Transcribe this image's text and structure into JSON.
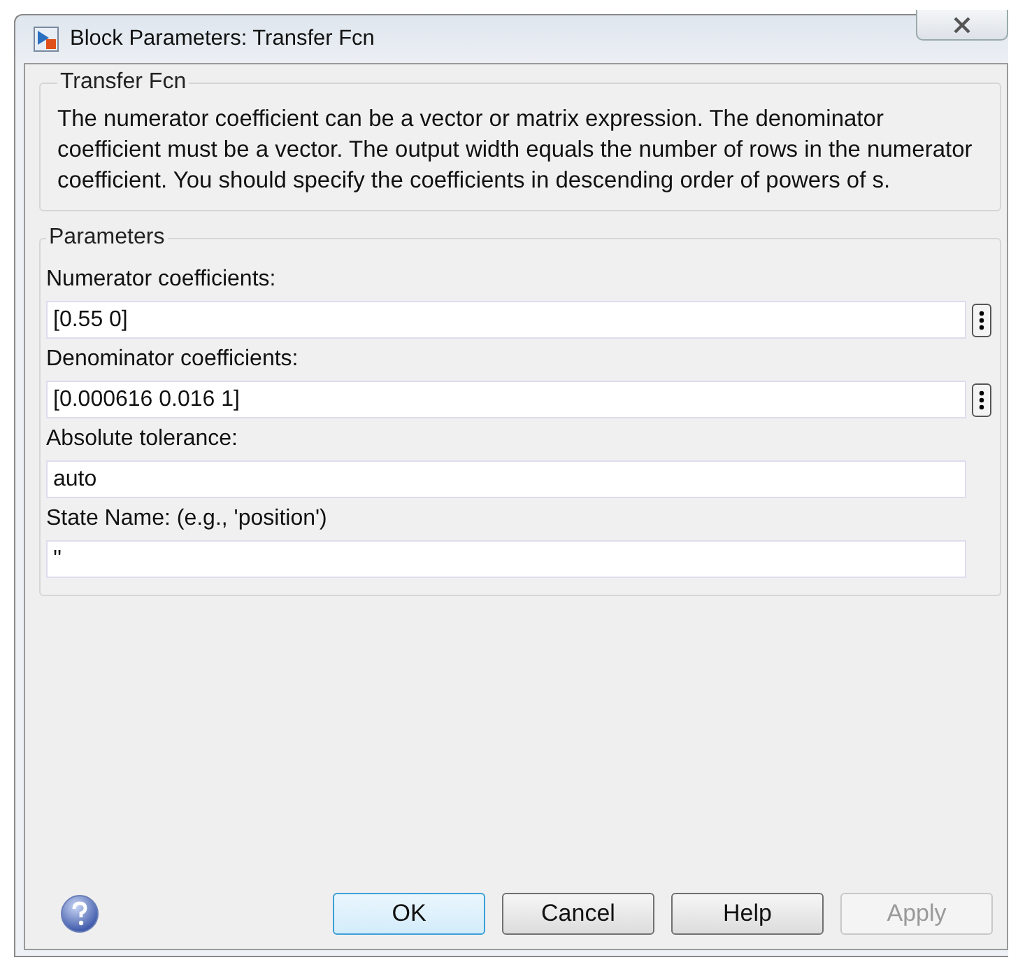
{
  "window": {
    "title": "Block Parameters: Transfer Fcn"
  },
  "description": {
    "title": "Transfer Fcn",
    "text": "The numerator coefficient can be a vector or matrix expression. The denominator coefficient must be a vector. The output width equals the number of rows in the numerator coefficient. You should specify the coefficients in descending order of powers of s."
  },
  "parameters": {
    "title": "Parameters",
    "fields": [
      {
        "label": "Numerator coefficients:",
        "value": "[0.55 0]",
        "has_menu": true
      },
      {
        "label": "Denominator coefficients:",
        "value": "[0.000616 0.016 1]",
        "has_menu": true
      },
      {
        "label": "Absolute tolerance:",
        "value": "auto",
        "has_menu": false
      },
      {
        "label": "State Name: (e.g., 'position')",
        "value": "''",
        "has_menu": false
      }
    ]
  },
  "buttons": [
    {
      "label": "OK",
      "default": true,
      "disabled": false
    },
    {
      "label": "Cancel",
      "default": false,
      "disabled": false
    },
    {
      "label": "Help",
      "default": false,
      "disabled": false
    },
    {
      "label": "Apply",
      "default": false,
      "disabled": true
    }
  ]
}
